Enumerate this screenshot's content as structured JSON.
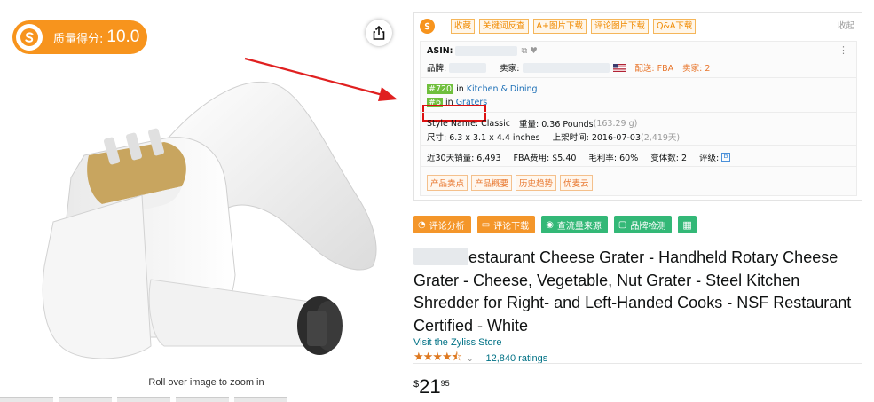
{
  "quality": {
    "label": "质量得分:",
    "score": "10.0"
  },
  "image": {
    "zoom_caption": "Roll over image to zoom in"
  },
  "plugin": {
    "toolbar": {
      "buttons": [
        "收藏",
        "关键词反查",
        "A+图片下载",
        "评论图片下载",
        "Q&A下载"
      ],
      "collapse": "收起"
    },
    "asin_label": "ASIN:",
    "brand_label": "品牌:",
    "seller_label": "卖家:",
    "fba_label": "配送: FBA",
    "sellers_count": "卖家: 2",
    "rank1": {
      "badge": "#720",
      "in": "in",
      "category": "Kitchen & Dining"
    },
    "rank2": {
      "badge": "#6",
      "in": "in",
      "category": "Graters"
    },
    "style": "Style Name: Classic",
    "weight_label": "重量: 0.36 Pounds",
    "weight_grams": "(163.29 g)",
    "size": "尺寸: 6.3 x 3.1 x 4.4 inches",
    "listed_label": "上架时间: 2016-07-03",
    "listed_days": "(2,419天)",
    "sales30": "近30天销量: 6,493",
    "fba_fee": "FBA费用: $5.40",
    "margin": "毛利率: 60%",
    "variants": "变体数: 2",
    "grade": "评级:",
    "tags": [
      "产品卖点",
      "产品概要",
      "历史趋势",
      "优麦云"
    ]
  },
  "actions": [
    {
      "label": "评论分析",
      "icon": "pie-chart-icon",
      "color": "#f4962a"
    },
    {
      "label": "评论下载",
      "icon": "comment-icon",
      "color": "#f4962a"
    },
    {
      "label": "查流量来源",
      "icon": "traffic-icon",
      "color": "#33b877"
    },
    {
      "label": "品牌检测",
      "icon": "brand-check-icon",
      "color": "#33b877"
    },
    {
      "label": "",
      "icon": "calculator-icon",
      "color": "#33b877"
    }
  ],
  "product": {
    "title": "estaurant Cheese Grater - Handheld Rotary Cheese Grater - Cheese, Vegetable, Nut Grater - Steel Kitchen Shredder for Right- and Left-Handed Cooks - NSF Restaurant Certified - White",
    "store_link": "Visit the Zyliss Store",
    "ratings": "12,840 ratings",
    "rating_value": 4.5,
    "price_symbol": "$",
    "price_whole": "21",
    "price_fraction": "95"
  },
  "colors": {
    "accent": "#f7941d",
    "highlight": "#dd1111",
    "link": "#007185",
    "green": "#33b877"
  }
}
